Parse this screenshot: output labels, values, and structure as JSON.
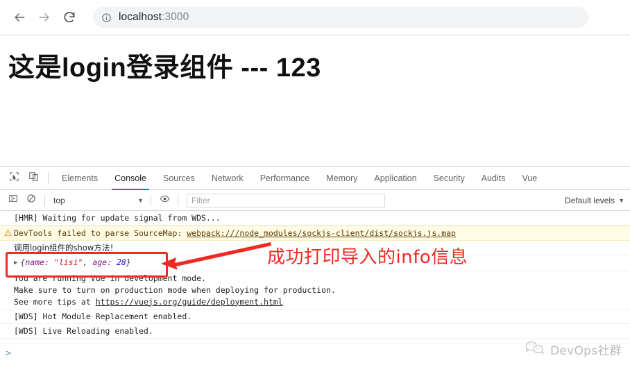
{
  "browser": {
    "back_icon": "arrow-left-icon",
    "forward_icon": "arrow-right-icon",
    "reload_icon": "reload-icon",
    "info_icon": "info-circle-icon",
    "url_host": "localhost",
    "url_port": ":3000",
    "url_full": "localhost:3000"
  },
  "page": {
    "heading": "这是login登录组件 --- 123"
  },
  "devtools": {
    "toolbar_icons": {
      "inspect": "inspect-element-icon",
      "device": "device-toolbar-icon"
    },
    "tabs": [
      {
        "label": "Elements",
        "active": false
      },
      {
        "label": "Console",
        "active": true
      },
      {
        "label": "Sources",
        "active": false
      },
      {
        "label": "Network",
        "active": false
      },
      {
        "label": "Performance",
        "active": false
      },
      {
        "label": "Memory",
        "active": false
      },
      {
        "label": "Application",
        "active": false
      },
      {
        "label": "Security",
        "active": false
      },
      {
        "label": "Audits",
        "active": false
      },
      {
        "label": "Vue",
        "active": false
      }
    ],
    "console_toolbar": {
      "sidebar_icon": "console-sidebar-icon",
      "clear_icon": "clear-console-icon",
      "context_value": "top",
      "context_caret": "▼",
      "eye_icon": "live-expression-eye-icon",
      "filter_placeholder": "Filter",
      "filter_value": "",
      "levels_label": "Default levels",
      "levels_caret": "▼"
    },
    "messages": {
      "hmr": "[HMR] Waiting for update signal from WDS...",
      "warn_prefix": "DevTools failed to parse SourceMap: ",
      "warn_link": "webpack:///node_modules/sockjs-client/dist/sockjs.js.map",
      "warn_icon": "warning-triangle-icon",
      "show_call": "调用login组件的show方法！",
      "object_triangle": "▶",
      "object_open": "{",
      "object_key1": "name: ",
      "object_val1": "\"lisi\"",
      "object_comma": ", ",
      "object_key2": "age: ",
      "object_val2": "28",
      "object_close": "}",
      "vue_line1": "You are running Vue in development mode.",
      "vue_line2": "Make sure to turn on production mode when deploying for production.",
      "vue_line3_prefix": "See more tips at ",
      "vue_line3_link": "https://vuejs.org/guide/deployment.html",
      "wds_hmr": "[WDS] Hot Module Replacement enabled.",
      "wds_live": "[WDS] Live Reloading enabled."
    },
    "prompt_caret": ">"
  },
  "annotation": {
    "text": "成功打印导入的info信息",
    "color": "#ef2b21",
    "box_target": "console-object-line",
    "arrow_icon": "annotation-arrow-icon"
  },
  "watermark": {
    "icon": "wechat-icon",
    "text": "DevOps社群"
  }
}
